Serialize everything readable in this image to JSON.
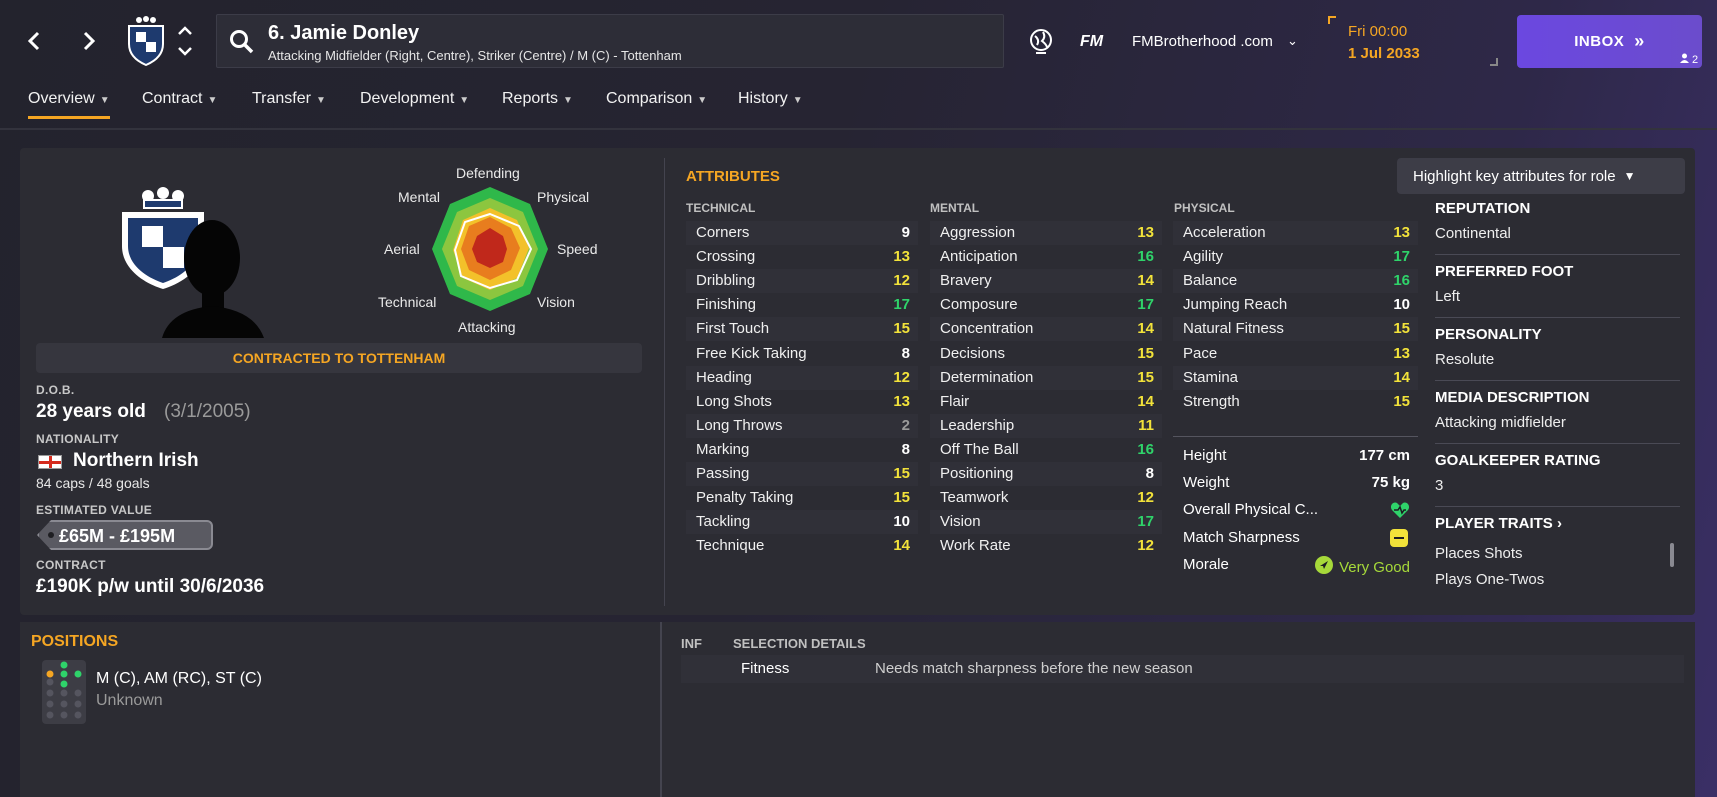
{
  "header": {
    "player_name": "6. Jamie Donley",
    "player_sub": "Attacking Midfielder (Right, Centre), Striker (Centre) / M (C) - Tottenham",
    "fm_label": "FM",
    "site": "FMBrotherhood .com",
    "day_time": "Fri 00:00",
    "date": "1 Jul 2033",
    "inbox_label": "INBOX",
    "inbox_count": "2",
    "icons": [
      "back-icon",
      "forward-icon",
      "club-badge-icon",
      "up-down-icon",
      "search-icon",
      "globe-icon",
      "chevron-down-icon",
      "double-chevron-icon",
      "user-icon"
    ]
  },
  "tabs": [
    "Overview",
    "Contract",
    "Transfer",
    "Development",
    "Reports",
    "Comparison",
    "History"
  ],
  "radar": {
    "labels": [
      "Defending",
      "Physical",
      "Speed",
      "Vision",
      "Attacking",
      "Technical",
      "Aerial",
      "Mental"
    ]
  },
  "profile": {
    "contract_banner": "CONTRACTED TO TOTTENHAM",
    "dob_label": "D.O.B.",
    "age": "28 years old",
    "dob": "(3/1/2005)",
    "nationality_label": "NATIONALITY",
    "nationality": "Northern Irish",
    "caps": "84 caps / 48 goals",
    "value_label": "ESTIMATED VALUE",
    "value": "£65M - £195M",
    "contract_label": "CONTRACT",
    "contract": "£190K p/w until 30/6/2036"
  },
  "attributes": {
    "title": "ATTRIBUTES",
    "highlight_button": "Highlight key attributes for role",
    "technical_label": "TECHNICAL",
    "mental_label": "MENTAL",
    "physical_label": "PHYSICAL",
    "technical": [
      [
        "Corners",
        "9"
      ],
      [
        "Crossing",
        "13"
      ],
      [
        "Dribbling",
        "12"
      ],
      [
        "Finishing",
        "17"
      ],
      [
        "First Touch",
        "15"
      ],
      [
        "Free Kick Taking",
        "8"
      ],
      [
        "Heading",
        "12"
      ],
      [
        "Long Shots",
        "13"
      ],
      [
        "Long Throws",
        "2"
      ],
      [
        "Marking",
        "8"
      ],
      [
        "Passing",
        "15"
      ],
      [
        "Penalty Taking",
        "15"
      ],
      [
        "Tackling",
        "10"
      ],
      [
        "Technique",
        "14"
      ]
    ],
    "mental": [
      [
        "Aggression",
        "13"
      ],
      [
        "Anticipation",
        "16"
      ],
      [
        "Bravery",
        "14"
      ],
      [
        "Composure",
        "17"
      ],
      [
        "Concentration",
        "14"
      ],
      [
        "Decisions",
        "15"
      ],
      [
        "Determination",
        "15"
      ],
      [
        "Flair",
        "14"
      ],
      [
        "Leadership",
        "11"
      ],
      [
        "Off The Ball",
        "16"
      ],
      [
        "Positioning",
        "8"
      ],
      [
        "Teamwork",
        "12"
      ],
      [
        "Vision",
        "17"
      ],
      [
        "Work Rate",
        "12"
      ]
    ],
    "physical": [
      [
        "Acceleration",
        "13"
      ],
      [
        "Agility",
        "17"
      ],
      [
        "Balance",
        "16"
      ],
      [
        "Jumping Reach",
        "10"
      ],
      [
        "Natural Fitness",
        "15"
      ],
      [
        "Pace",
        "13"
      ],
      [
        "Stamina",
        "14"
      ],
      [
        "Strength",
        "15"
      ]
    ],
    "height_label": "Height",
    "height": "177 cm",
    "weight_label": "Weight",
    "weight": "75 kg",
    "overall_label": "Overall Physical C...",
    "sharpness_label": "Match Sharpness",
    "morale_label": "Morale",
    "morale": "Very Good"
  },
  "info": {
    "reputation_label": "REPUTATION",
    "reputation": "Continental",
    "foot_label": "PREFERRED FOOT",
    "foot": "Left",
    "personality_label": "PERSONALITY",
    "personality": "Resolute",
    "media_label": "MEDIA DESCRIPTION",
    "media": "Attacking midfielder",
    "gk_label": "GOALKEEPER RATING",
    "gk": "3",
    "traits_label": "PLAYER TRAITS",
    "traits": [
      "Places Shots",
      "Plays One-Twos"
    ]
  },
  "positions": {
    "title": "POSITIONS",
    "list": "M (C), AM (RC), ST (C)",
    "status": "Unknown"
  },
  "selection": {
    "inf_label": "INF",
    "title": "SELECTION DETAILS",
    "row_label": "Fitness",
    "row_text": "Needs match sharpness before the new season"
  },
  "colors": {
    "accent": "#f5a623",
    "inbox": "#6b48e0",
    "green": "#2fd36a",
    "yellow": "#f2e23a",
    "white": "#ffffff",
    "grey": "#9a9a9a"
  }
}
